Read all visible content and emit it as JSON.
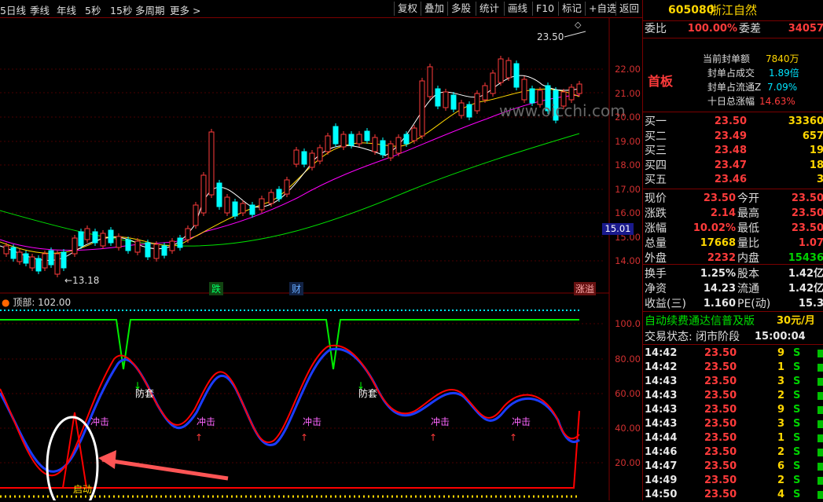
{
  "toolbar": {
    "left_items": [
      "5日线",
      "季线",
      "年线",
      "5秒",
      "15秒",
      "多周期",
      "更多 >"
    ],
    "right_items": [
      "复权",
      "叠加",
      "多股",
      "统计",
      "画线",
      "F10",
      "标记",
      "+自选",
      "返回"
    ]
  },
  "chart": {
    "price_labels": [
      "22.00",
      "21.00",
      "20.00",
      "19.00",
      "18.00",
      "17.00",
      "16.00",
      "15.00",
      "14.00"
    ],
    "current_price_tag": "15.01",
    "high_marker": "23.50",
    "low_marker": "13.18",
    "watermark": "www.oicchi.com",
    "event_labels": [
      "跌",
      "财",
      "涨溢"
    ],
    "colors": {
      "ma5": "#ffffff",
      "ma10": "#ffd700",
      "ma20": "#ff00ff",
      "ma60": "#00e000",
      "up": "#ff3b3b",
      "down": "#00ffff",
      "osc_red": "#ff0000",
      "osc_blue": "#1b3cff"
    }
  },
  "oscillator": {
    "title": "顶部: 102.00",
    "levels": [
      "100.0",
      "80.00",
      "60.00",
      "40.00",
      "20.00"
    ],
    "annotations": [
      "冲击",
      "防套",
      "启动"
    ]
  },
  "quote": {
    "code": "605080",
    "name": "浙江自然",
    "weibi_label": "委比",
    "weibi_value": "100.00%",
    "weicha_label": "委差",
    "weicha_value": "34057",
    "tag": "首板",
    "limit_stats": [
      {
        "label": "当前封单额",
        "value": "7840万"
      },
      {
        "label": "封单占成交",
        "value": "1.89倍"
      },
      {
        "label": "封单占流通Z",
        "value": "7.09%"
      },
      {
        "label": "十日总涨幅",
        "value": "14.63%"
      }
    ],
    "bids": [
      {
        "label": "买一",
        "price": "23.50",
        "vol": "33360"
      },
      {
        "label": "买二",
        "price": "23.49",
        "vol": "657"
      },
      {
        "label": "买三",
        "price": "23.48",
        "vol": "19"
      },
      {
        "label": "买四",
        "price": "23.47",
        "vol": "18"
      },
      {
        "label": "买五",
        "price": "23.46",
        "vol": "3"
      }
    ],
    "stats": [
      {
        "l1": "现价",
        "v1": "23.50",
        "l2": "今开",
        "v2": "23.50"
      },
      {
        "l1": "涨跌",
        "v1": "2.14",
        "l2": "最高",
        "v2": "23.50"
      },
      {
        "l1": "涨幅",
        "v1": "10.02%",
        "l2": "最低",
        "v2": "23.50"
      },
      {
        "l1": "总量",
        "v1": "17668",
        "l2": "量比",
        "v2": "1.07"
      },
      {
        "l1": "外盘",
        "v1": "2232",
        "l2": "内盘",
        "v2": "15436"
      }
    ],
    "stats2": [
      {
        "l1": "换手",
        "v1": "1.25%",
        "l2": "股本",
        "v2": "1.42亿"
      },
      {
        "l1": "净资",
        "v1": "14.23",
        "l2": "流通",
        "v2": "1.42亿"
      },
      {
        "l1": "收益(三)",
        "v1": "1.160",
        "l2": "PE(动)",
        "v2": "15.3"
      }
    ],
    "promo": "自动续费通达信普及版",
    "promo_price": "30元/月",
    "trade_status_label": "交易状态: 闭市阶段",
    "trade_status_time": "15:00:04",
    "trades": [
      {
        "time": "14:42",
        "price": "23.50",
        "vol": "9",
        "side": "S"
      },
      {
        "time": "14:42",
        "price": "23.50",
        "vol": "1",
        "side": "S"
      },
      {
        "time": "14:43",
        "price": "23.50",
        "vol": "3",
        "side": "S"
      },
      {
        "time": "14:43",
        "price": "23.50",
        "vol": "2",
        "side": "S"
      },
      {
        "time": "14:43",
        "price": "23.50",
        "vol": "9",
        "side": "S"
      },
      {
        "time": "14:43",
        "price": "23.50",
        "vol": "3",
        "side": "S"
      },
      {
        "time": "14:44",
        "price": "23.50",
        "vol": "1",
        "side": "S"
      },
      {
        "time": "14:46",
        "price": "23.50",
        "vol": "2",
        "side": "S"
      },
      {
        "time": "14:47",
        "price": "23.50",
        "vol": "6",
        "side": "S"
      },
      {
        "time": "14:49",
        "price": "23.50",
        "vol": "2",
        "side": "S"
      },
      {
        "time": "14:50",
        "price": "23.50",
        "vol": "4",
        "side": "S"
      }
    ]
  }
}
